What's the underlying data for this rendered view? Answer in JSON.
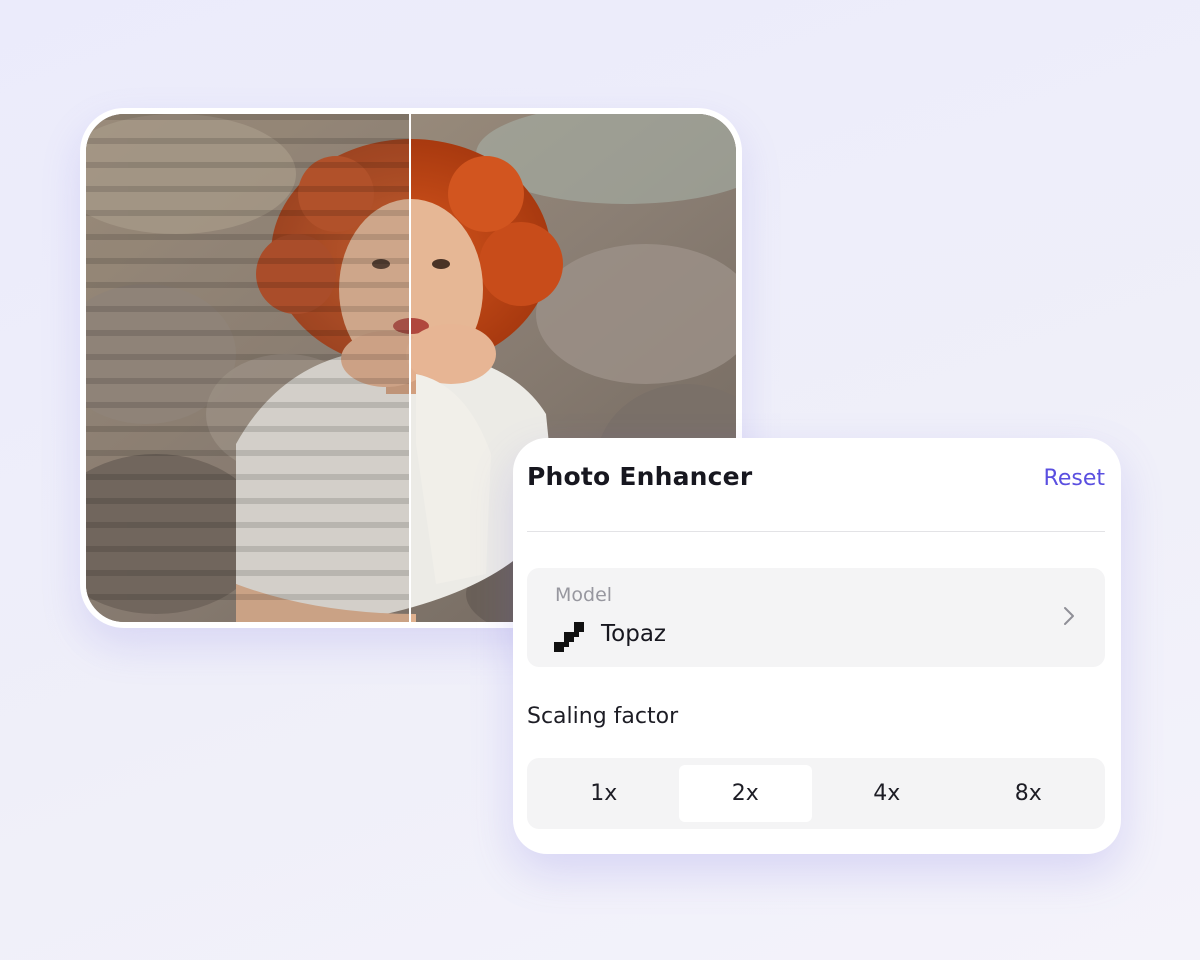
{
  "comparison": {
    "image": "before-after-portrait-photo",
    "divider": "comparison-slider-line"
  },
  "panel": {
    "title": "Photo Enhancer",
    "reset_label": "Reset",
    "model": {
      "caption": "Model",
      "value": "Topaz",
      "icon": "topaz-pixel-icon",
      "chevron_icon": "chevron-right-icon"
    },
    "scaling": {
      "label": "Scaling factor",
      "options": [
        "1x",
        "2x",
        "4x",
        "8x"
      ],
      "selected": "2x"
    }
  },
  "colors": {
    "accent": "#5a4fe0",
    "background": "#ebebfb",
    "panel": "#ffffff",
    "field": "#f4f4f5"
  }
}
